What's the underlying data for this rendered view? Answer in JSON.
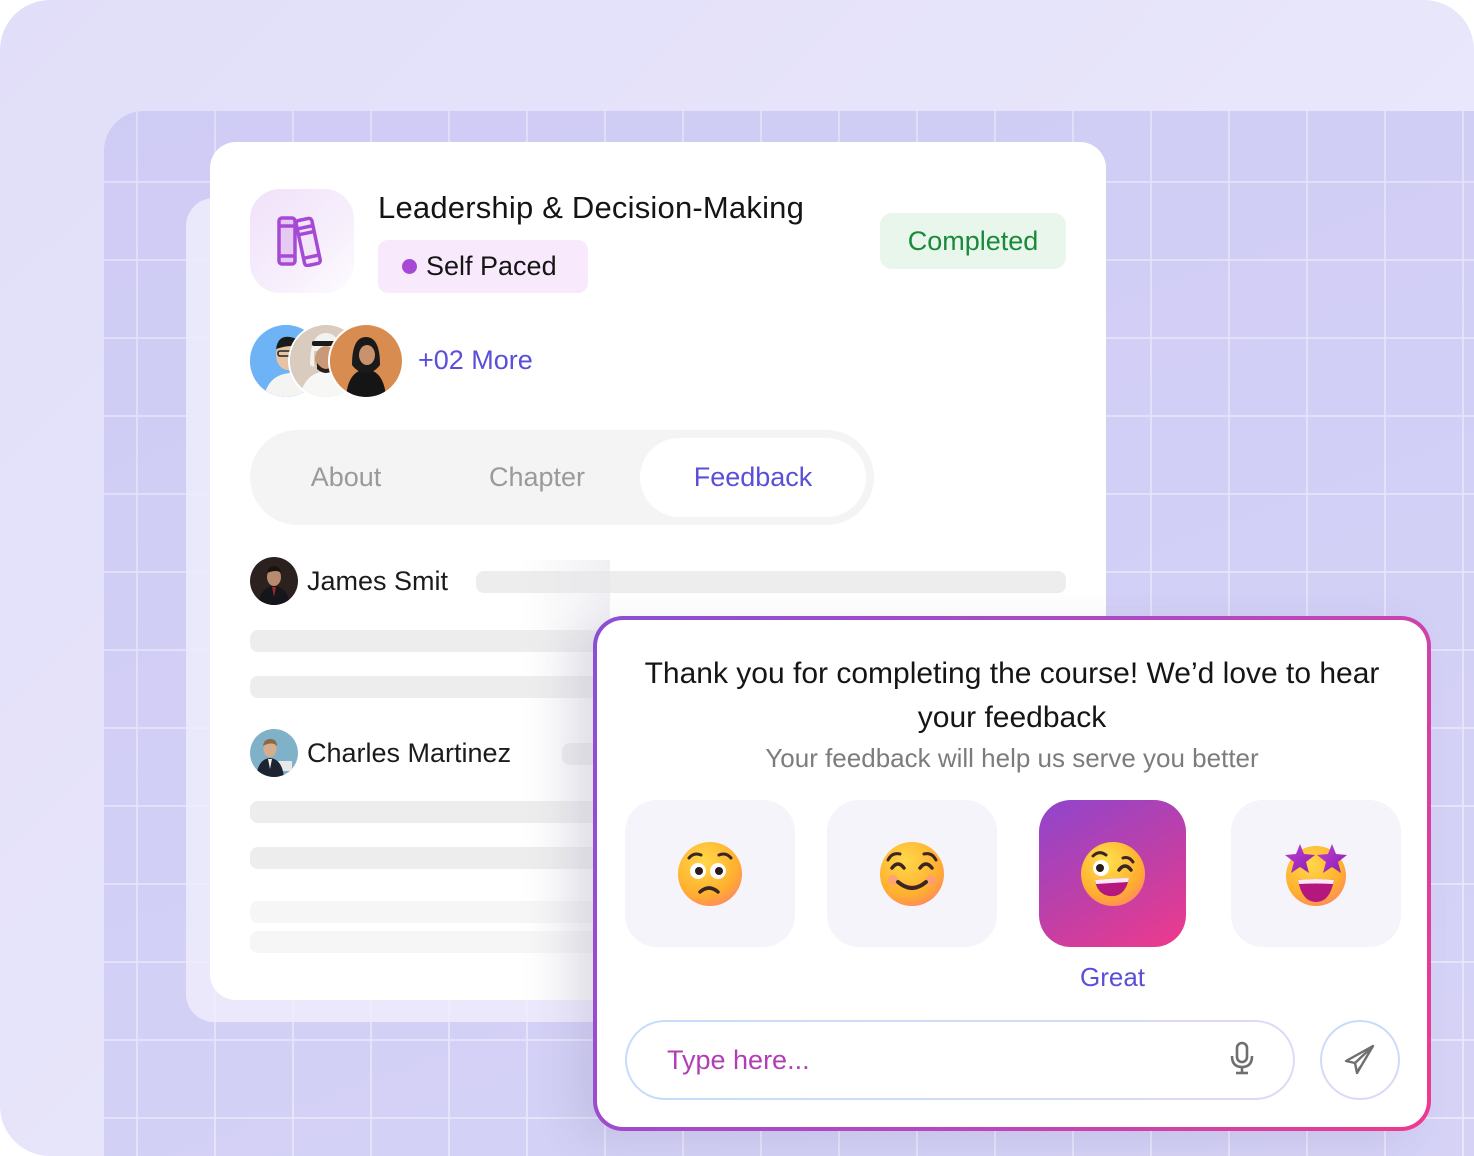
{
  "course": {
    "title": "Leadership & Decision-Making",
    "pace_label": "Self Paced",
    "status": "Completed",
    "icon": "books-icon",
    "participants_more": "+02 More",
    "colors": {
      "accent": "#5a4fd9",
      "pace_dot": "#a64ad6",
      "status_text": "#1a8a3a",
      "status_bg": "#e8f6ec"
    }
  },
  "tabs": [
    {
      "label": "About",
      "active": false
    },
    {
      "label": "Chapter",
      "active": false
    },
    {
      "label": "Feedback",
      "active": true
    }
  ],
  "reviews": [
    {
      "name": "James Smit"
    },
    {
      "name": "Charles Martinez"
    }
  ],
  "feedback": {
    "title": "Thank you for completing the course! We’d love to hear your feedback",
    "subtitle": "Your feedback will help us serve you better",
    "options": [
      {
        "emoji": "😟",
        "icon": "worried-face-icon",
        "label": "",
        "selected": false
      },
      {
        "emoji": "😊",
        "icon": "smiling-face-icon",
        "label": "",
        "selected": false
      },
      {
        "emoji": "😜",
        "icon": "winking-face-icon",
        "label": "Great",
        "selected": true
      },
      {
        "emoji": "🤩",
        "icon": "star-struck-face-icon",
        "label": "",
        "selected": false
      }
    ],
    "input_placeholder": "Type here...",
    "input_value": "",
    "mic_icon": "microphone-icon",
    "send_icon": "paper-plane-icon",
    "gradient": [
      "#8a4fd6",
      "#ef3a8c"
    ]
  }
}
